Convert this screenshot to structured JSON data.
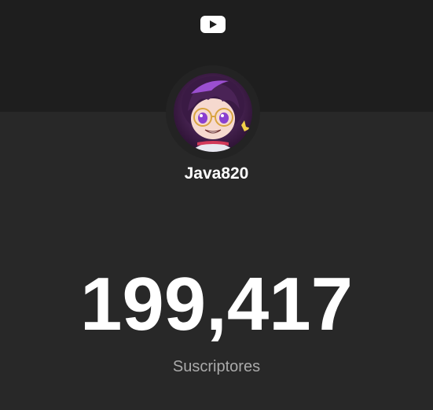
{
  "header": {
    "logo_icon": "youtube-play-icon",
    "logo_color": "#ffffff"
  },
  "channel": {
    "name": "Java820",
    "avatar_icon": "channel-avatar-anime-character"
  },
  "stats": {
    "subscriber_count": "199,417",
    "subscriber_label": "Suscriptores"
  },
  "colors": {
    "background": "#282828",
    "header_band": "#1e1e1e",
    "primary_text": "#ffffff",
    "secondary_text": "#aaaaaa"
  }
}
